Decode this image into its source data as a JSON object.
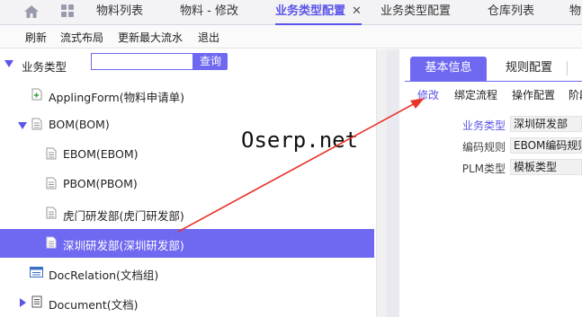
{
  "tabs": [
    {
      "label": "物料列表"
    },
    {
      "label": "物料 - 修改"
    },
    {
      "label": "业务类型配置",
      "active": true,
      "close": "✕"
    },
    {
      "label": "业务类型配置"
    },
    {
      "label": "仓库列表"
    },
    {
      "label": "物"
    }
  ],
  "toolbar": {
    "refresh": "刷新",
    "flow_layout": "流式布局",
    "update_max_flow": "更新最大流水",
    "exit": "退出"
  },
  "tree": {
    "root_label": "业务类型",
    "search_placeholder": "",
    "search_button": "查询",
    "items": [
      {
        "label": "ApplingForm(物料申请单)",
        "icon": "doc-add-icon"
      },
      {
        "label": "BOM(BOM)",
        "icon": "doc-icon",
        "expanded": true
      },
      {
        "label": "EBOM(EBOM)",
        "icon": "doc-icon"
      },
      {
        "label": "PBOM(PBOM)",
        "icon": "doc-icon"
      },
      {
        "label": "虎门研发部(虎门研发部)",
        "icon": "doc-icon"
      },
      {
        "label": "深圳研发部(深圳研发部)",
        "icon": "doc-icon",
        "selected": true
      },
      {
        "label": "DocRelation(文档组)",
        "icon": "window-icon"
      },
      {
        "label": "Document(文档)",
        "icon": "doc-icon",
        "expanded": false
      }
    ]
  },
  "right_panel": {
    "tabs": {
      "basic": "基本信息",
      "rules": "规则配置"
    },
    "subtabs": {
      "edit": "修改",
      "bind_flow": "绑定流程",
      "op_config": "操作配置",
      "stage": "阶段"
    },
    "fields": {
      "type_label": "业务类型",
      "type_value": "深圳研发部",
      "code_rule_label": "编码规则",
      "code_rule_value": "EBOM编码规则",
      "plm_type_label": "PLM类型",
      "plm_type_value": "模板类型"
    }
  },
  "watermark": "Oserp.net",
  "colors": {
    "accent": "#6e69f0",
    "arrow": "#e8342a"
  }
}
